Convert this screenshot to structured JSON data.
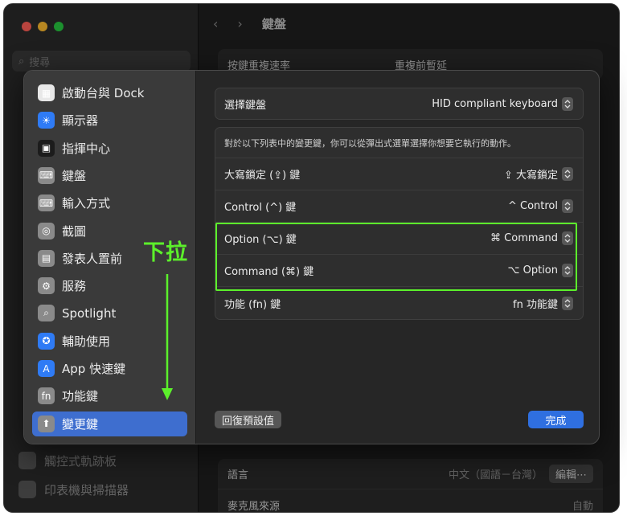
{
  "background": {
    "search_placeholder": "搜尋",
    "header_title": "鍵盤",
    "row1_left": "按鍵重複速率",
    "row1_right": "重複前暫延",
    "sidebar_bottom_1": "觸控式軌跡板",
    "sidebar_bottom_2": "印表機與掃描器",
    "language_label": "語言",
    "language_value": "中文（國語－台灣）",
    "edit_button": "編輯⋯",
    "mic_label": "麥克風來源",
    "mic_value": "自動"
  },
  "sheet": {
    "sidebar": [
      {
        "label": "啟動台與 Dock",
        "icon": "launchpad-icon",
        "color": "#e8e8e8"
      },
      {
        "label": "顯示器",
        "icon": "display-icon",
        "color": "#2f7bf5"
      },
      {
        "label": "指揮中心",
        "icon": "mission-control-icon",
        "color": "#1c1c1c"
      },
      {
        "label": "鍵盤",
        "icon": "keyboard-icon",
        "color": "#8a8a8a"
      },
      {
        "label": "輸入方式",
        "icon": "input-sources-icon",
        "color": "#8a8a8a"
      },
      {
        "label": "截圖",
        "icon": "screenshot-icon",
        "color": "#8a8a8a"
      },
      {
        "label": "發表人置前",
        "icon": "presenter-icon",
        "color": "#8a8a8a"
      },
      {
        "label": "服務",
        "icon": "services-gear-icon",
        "color": "#8a8a8a"
      },
      {
        "label": "Spotlight",
        "icon": "spotlight-icon",
        "color": "#8a8a8a"
      },
      {
        "label": "輔助使用",
        "icon": "accessibility-icon",
        "color": "#2f7bf5"
      },
      {
        "label": "App 快速鍵",
        "icon": "app-store-icon",
        "color": "#2f7bf5"
      },
      {
        "label": "功能鍵",
        "icon": "fn-key-icon",
        "color": "#8a8a8a"
      },
      {
        "label": "變更鍵",
        "icon": "modifier-keys-icon",
        "color": "#8a8a8a"
      }
    ],
    "keyboard_label": "選擇鍵盤",
    "keyboard_value": "HID compliant keyboard",
    "description": "對於以下列表中的變更鍵，你可以從彈出式選單選擇你想要它執行的動作。",
    "modifiers": [
      {
        "label": "大寫鎖定 (⇪) 鍵",
        "value": "⇪ 大寫鎖定"
      },
      {
        "label": "Control (^) 鍵",
        "value": "^ Control"
      },
      {
        "label": "Option (⌥) 鍵",
        "value": "⌘ Command"
      },
      {
        "label": "Command (⌘) 鍵",
        "value": "⌥ Option"
      },
      {
        "label": "功能 (fn) 鍵",
        "value": "fn 功能鍵"
      }
    ],
    "reset_button": "回復預設值",
    "done_button": "完成"
  },
  "annotation": {
    "text": "下拉",
    "color": "#5cf02b"
  }
}
